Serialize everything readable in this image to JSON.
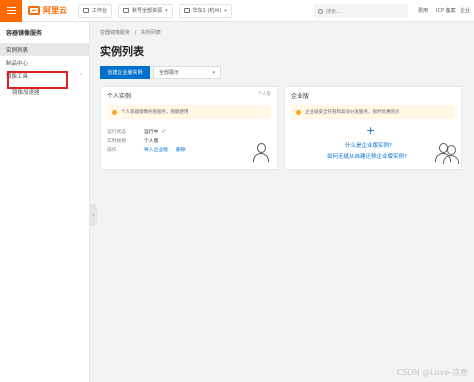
{
  "topbar": {
    "logo_text": "阿里云",
    "nav": [
      {
        "label": "工作台",
        "icon": "home-icon"
      },
      {
        "label": "账号全部资源",
        "icon": "resource-icon"
      },
      {
        "label": "华东1 (杭州)",
        "icon": "location-icon"
      }
    ],
    "search_placeholder": "搜索...",
    "links": [
      "费用",
      "ICP 备案",
      "企业"
    ]
  },
  "sidebar": {
    "title": "容器镜像服务",
    "items": [
      {
        "label": "实例列表",
        "active": true
      },
      {
        "label": "制品中心",
        "active": false
      },
      {
        "label": "镜像工具",
        "active": false,
        "expandable": true
      }
    ],
    "subitems": [
      {
        "label": "镜像加速器"
      }
    ]
  },
  "main": {
    "breadcrumb": [
      "容器镜像服务",
      "实例列表"
    ],
    "breadcrumb_sep": "/",
    "title": "实例列表",
    "create_button": "创建企业版实例",
    "filter_select": "全部展示"
  },
  "personal_card": {
    "title": "个人实例",
    "badge": "个人版",
    "notice": "个人容器镜像托管服务，限额使用",
    "rows": [
      {
        "label": "运行状态",
        "value": "运行中"
      },
      {
        "label": "实例规格",
        "value": "个人版"
      },
      {
        "label": "操作",
        "links": [
          "导入企业版",
          "删除"
        ]
      }
    ]
  },
  "enterprise_card": {
    "title": "企业版",
    "badge": "",
    "notice": "企业级安全托管和高效分发服务，限时优惠购买",
    "link1": "什么是企业版实例?",
    "link2": "如何无缝从自建迁移企业版实例?"
  },
  "watermark": "CSDN @Love-凉息",
  "colors": {
    "brand": "#ff6a00",
    "primary": "#0070cc",
    "highlight": "#e02020",
    "success": "#2ba24c"
  }
}
